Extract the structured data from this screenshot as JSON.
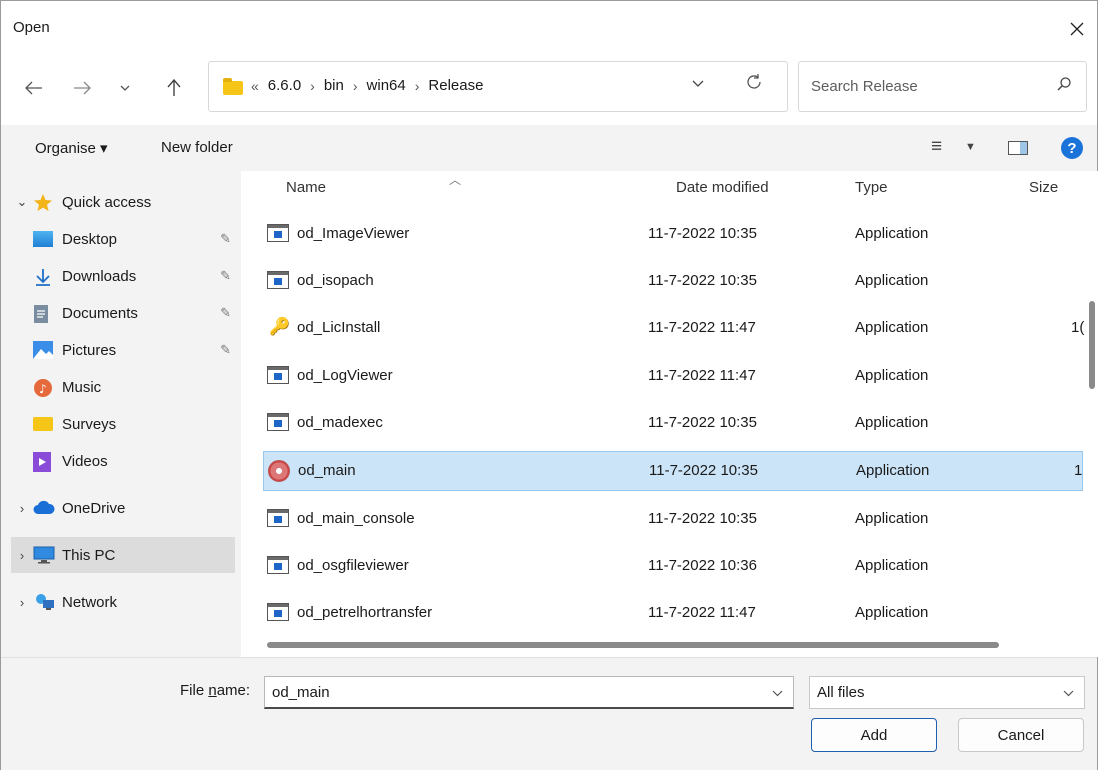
{
  "window": {
    "title": "Open"
  },
  "address": {
    "crumbs": [
      "6.6.0",
      "bin",
      "win64",
      "Release"
    ],
    "lead": "«",
    "separator": "›"
  },
  "search": {
    "placeholder": "Search Release"
  },
  "commandbar": {
    "organise_label": "Organise ▾",
    "new_folder_label": "New folder"
  },
  "sidebar": {
    "items": [
      {
        "label": "Quick access",
        "icon": "star-icon",
        "pinned": false,
        "expanded": true
      },
      {
        "label": "Desktop",
        "icon": "desktop-icon",
        "pinned": true
      },
      {
        "label": "Downloads",
        "icon": "download-arrow-icon",
        "pinned": true
      },
      {
        "label": "Documents",
        "icon": "document-icon",
        "pinned": true
      },
      {
        "label": "Pictures",
        "icon": "pictures-icon",
        "pinned": true
      },
      {
        "label": "Music",
        "icon": "music-icon",
        "pinned": false
      },
      {
        "label": "Surveys",
        "icon": "folder-icon",
        "pinned": false
      },
      {
        "label": "Videos",
        "icon": "videos-icon",
        "pinned": false
      },
      {
        "label": "OneDrive",
        "icon": "cloud-icon",
        "expanded": false
      },
      {
        "label": "This PC",
        "icon": "computer-icon",
        "expanded": false,
        "selected": true
      },
      {
        "label": "Network",
        "icon": "network-icon",
        "expanded": false
      }
    ]
  },
  "columns": {
    "name": "Name",
    "date": "Date modified",
    "type": "Type",
    "size": "Size"
  },
  "files": [
    {
      "name": "od_ImageViewer",
      "date": "11-7-2022 10:35",
      "type": "Application",
      "icon": "app-window-icon"
    },
    {
      "name": "od_isopach",
      "date": "11-7-2022 10:35",
      "type": "Application",
      "icon": "app-window-icon"
    },
    {
      "name": "od_LicInstall",
      "date": "11-7-2022 11:47",
      "type": "Application",
      "icon": "key-gear-icon",
      "size_visible": "1("
    },
    {
      "name": "od_LogViewer",
      "date": "11-7-2022 11:47",
      "type": "Application",
      "icon": "app-window-icon"
    },
    {
      "name": "od_madexec",
      "date": "11-7-2022 10:35",
      "type": "Application",
      "icon": "app-window-icon"
    },
    {
      "name": "od_main",
      "date": "11-7-2022 10:35",
      "type": "Application",
      "icon": "disc-icon",
      "selected": true,
      "size_visible": "1"
    },
    {
      "name": "od_main_console",
      "date": "11-7-2022 10:35",
      "type": "Application",
      "icon": "app-window-icon"
    },
    {
      "name": "od_osgfileviewer",
      "date": "11-7-2022 10:36",
      "type": "Application",
      "icon": "app-window-icon"
    },
    {
      "name": "od_petrelhortransfer",
      "date": "11-7-2022 11:47",
      "type": "Application",
      "icon": "app-window-icon"
    }
  ],
  "footer": {
    "file_name_label": "File name:",
    "file_name_underline": "n",
    "file_name_value": "od_main",
    "file_type_value": "All files",
    "add_label": "Add",
    "cancel_label": "Cancel"
  },
  "colors": {
    "accent": "#1a73d9",
    "selection": "#cce4f7",
    "pane": "#f3f3f3"
  }
}
